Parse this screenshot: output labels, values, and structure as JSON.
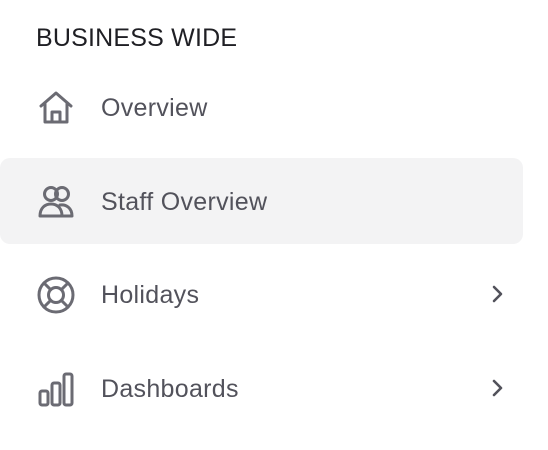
{
  "section": {
    "title": "BUSINESS WIDE"
  },
  "items": [
    {
      "label": "Overview",
      "icon": "home-icon",
      "active": false,
      "has_chevron": false
    },
    {
      "label": "Staff Overview",
      "icon": "users-icon",
      "active": true,
      "has_chevron": false
    },
    {
      "label": "Holidays",
      "icon": "lifebuoy-icon",
      "active": false,
      "has_chevron": true
    },
    {
      "label": "Dashboards",
      "icon": "bar-chart-icon",
      "active": false,
      "has_chevron": true
    }
  ],
  "colors": {
    "active_background": "#f3f3f4",
    "label_text": "#52525b",
    "icon_stroke": "#6b6b73",
    "heading_text": "#1f1f24"
  }
}
